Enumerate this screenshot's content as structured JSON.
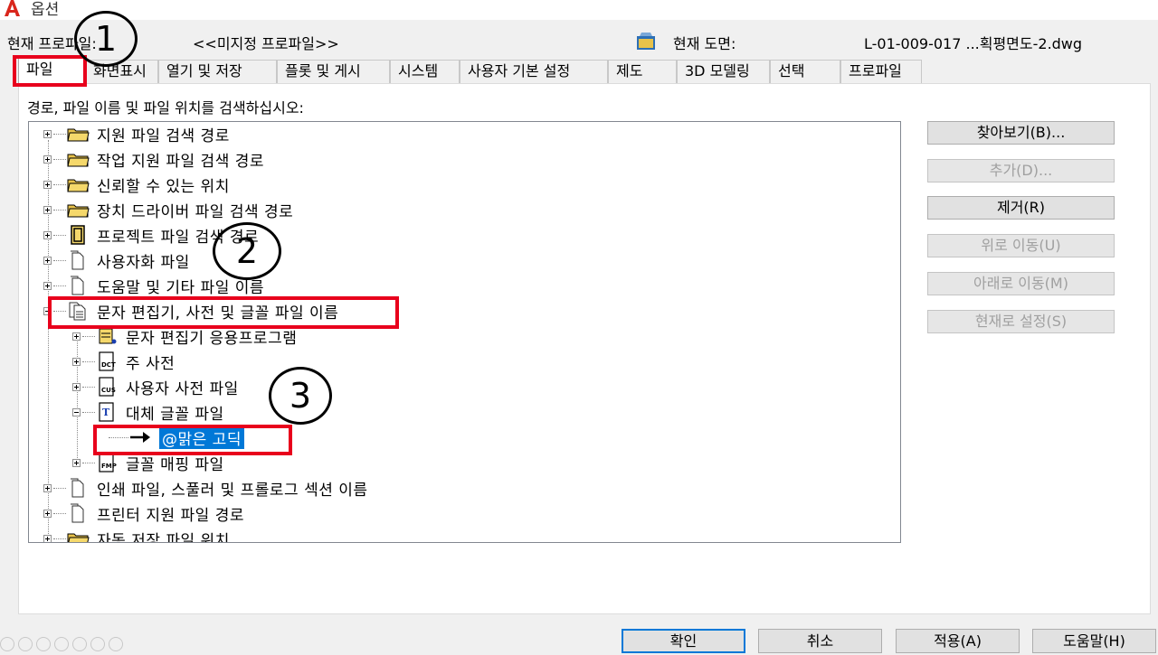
{
  "window": {
    "title": "옵션"
  },
  "info": {
    "profile_label": "현재 프로파일:",
    "profile_value": "<<미지정 프로파일>>",
    "drawing_label": "현재 도면:",
    "drawing_value": "L-01-009-017 ...획평면도-2.dwg"
  },
  "tabs": [
    "파일",
    "화면표시",
    "열기 및 저장",
    "플롯 및 게시",
    "시스템",
    "사용자 기본 설정",
    "제도",
    "3D 모델링",
    "선택",
    "프로파일"
  ],
  "heading": "경로, 파일 이름 및 파일 위치를 검색하십시오:",
  "tree": {
    "items": [
      {
        "label": "지원 파일 검색 경로",
        "icon": "folder-icon"
      },
      {
        "label": "작업 지원 파일 검색 경로",
        "icon": "folder-icon"
      },
      {
        "label": "신뢰할 수 있는 위치",
        "icon": "folder-icon"
      },
      {
        "label": "장치 드라이버 파일 검색 경로",
        "icon": "folder-icon"
      },
      {
        "label": "프로젝트 파일 검색 경로",
        "icon": "project-icon"
      },
      {
        "label": "사용자화 파일",
        "icon": "document-icon"
      },
      {
        "label": "도움말 및 기타 파일 이름",
        "icon": "document-icon"
      },
      {
        "label": "문자 편집기, 사전 및 글꼴 파일 이름",
        "icon": "documents-icon"
      },
      {
        "label": "문자 편집기 응용프로그램",
        "icon": "text-editor-icon"
      },
      {
        "label": "주 사전",
        "icon": "dictionary-icon"
      },
      {
        "label": "사용자 사전 파일",
        "icon": "custom-dictionary-icon"
      },
      {
        "label": "대체 글꼴 파일",
        "icon": "font-file-icon"
      },
      {
        "label": "@맑은 고딕",
        "icon": "arrow-right-icon"
      },
      {
        "label": "글꼴 매핑 파일",
        "icon": "font-map-icon"
      },
      {
        "label": "인쇄 파일, 스풀러 및 프롤로그 섹션 이름",
        "icon": "document-icon"
      },
      {
        "label": "프린터 지원 파일 경로",
        "icon": "document-icon"
      },
      {
        "label": "자동 저장 파일 위치",
        "icon": "folder-icon"
      }
    ]
  },
  "side_buttons": [
    {
      "label": "찾아보기(B)...",
      "enabled": true
    },
    {
      "label": "추가(D)...",
      "enabled": false
    },
    {
      "label": "제거(R)",
      "enabled": true
    },
    {
      "label": "위로 이동(U)",
      "enabled": false
    },
    {
      "label": "아래로 이동(M)",
      "enabled": false
    },
    {
      "label": "현재로 설정(S)",
      "enabled": false
    }
  ],
  "bottom_buttons": [
    "확인",
    "취소",
    "적용(A)",
    "도움말(H)"
  ],
  "annotations": [
    "1",
    "2",
    "3"
  ],
  "colors": {
    "highlight_red": "#e8001c",
    "selection_blue": "#0078d7"
  }
}
